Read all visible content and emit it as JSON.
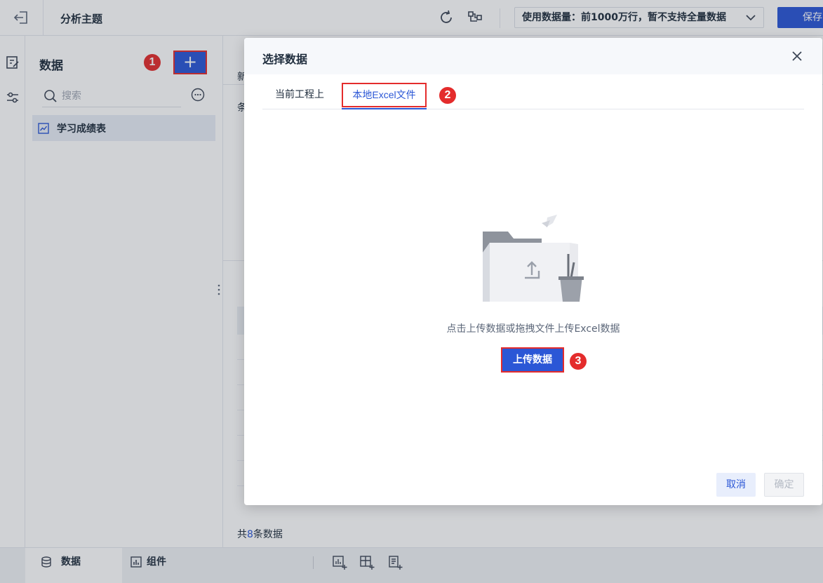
{
  "topbar": {
    "title": "分析主题",
    "data_volume": "使用数据量：前1000万行，暂不支持全量数据",
    "save_label": "保存"
  },
  "data_panel": {
    "title": "数据",
    "search_placeholder": "搜索",
    "items": [
      {
        "label": "学习成绩表"
      }
    ]
  },
  "background": {
    "fragment_1": "新",
    "fragment_2": "条",
    "total_prefix": "共",
    "total_count": "8",
    "total_suffix": "条数据"
  },
  "bottom_bar": {
    "tab_data": "数据",
    "tab_components": "组件"
  },
  "modal": {
    "title": "选择数据",
    "tabs": [
      {
        "label": "当前工程上"
      },
      {
        "label": "本地Excel文件"
      }
    ],
    "hint": "点击上传数据或拖拽文件上传Excel数据",
    "upload_label": "上传数据",
    "cancel_label": "取消",
    "confirm_label": "确定"
  },
  "markers": [
    "1",
    "2",
    "3"
  ],
  "colors": {
    "accent": "#2b57d6",
    "highlight_border": "#e42c2c"
  }
}
